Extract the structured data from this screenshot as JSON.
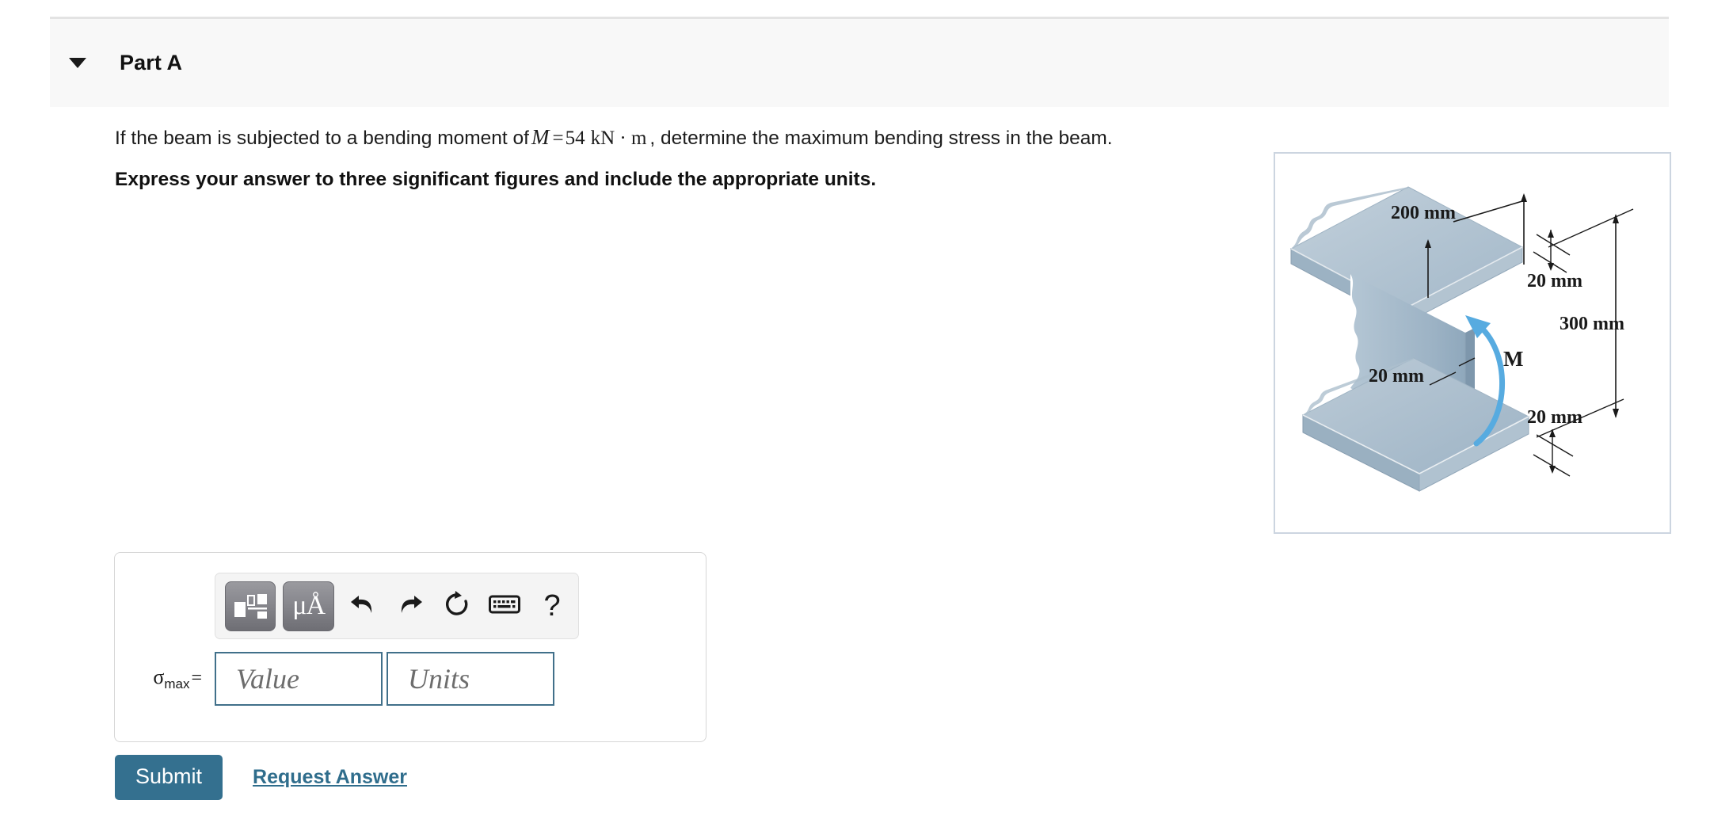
{
  "header": {
    "part_label": "Part A",
    "disclosure_icon": "caret-down-icon"
  },
  "question": {
    "text_before_var": "If the beam is subjected to a bending moment of",
    "moment_symbol": "M",
    "equals": "=",
    "moment_value": "54",
    "moment_units": "kN · m",
    "text_after": ", determine the maximum bending stress in the beam.",
    "instruction": "Express your answer to three significant figures and include the appropriate units."
  },
  "figure": {
    "alt": "Isometric view of a wide-flange I-beam cross section with applied bending moment",
    "labels": {
      "flange_width": "200 mm",
      "top_flange_thickness": "20 mm",
      "total_depth": "300 mm",
      "bottom_flange_thickness": "20 mm",
      "web_thickness": "20 mm",
      "moment": "M"
    },
    "colors": {
      "border": "#ccd5e0",
      "steel_light": "#b9c9d6",
      "steel_mid": "#a4b9c9",
      "steel_dark": "#8ba4b8",
      "steel_edge": "#7e97ac",
      "moment_arrow": "#57abe0"
    }
  },
  "answer_panel": {
    "toolbar": {
      "buttons": [
        {
          "name": "math-template-button",
          "label": "template"
        },
        {
          "name": "units-button",
          "label": "μÅ"
        },
        {
          "name": "undo-button",
          "label": "undo"
        },
        {
          "name": "redo-button",
          "label": "redo"
        },
        {
          "name": "reset-button",
          "label": "reset"
        },
        {
          "name": "keyboard-button",
          "label": "keyboard"
        },
        {
          "name": "help-button",
          "label": "?"
        }
      ],
      "help_glyph": "?",
      "units_glyph": "μÅ"
    },
    "variable": "σ",
    "variable_subscript": "max",
    "equals": "=",
    "value_placeholder": "Value",
    "units_placeholder": "Units",
    "value_current": "",
    "units_current": ""
  },
  "actions": {
    "submit_label": "Submit",
    "request_answer_label": "Request Answer"
  },
  "colors": {
    "accent_teal": "#34708f",
    "link_teal": "#2f6d8c",
    "input_border": "#41708a",
    "header_bg": "#f8f8f8"
  }
}
